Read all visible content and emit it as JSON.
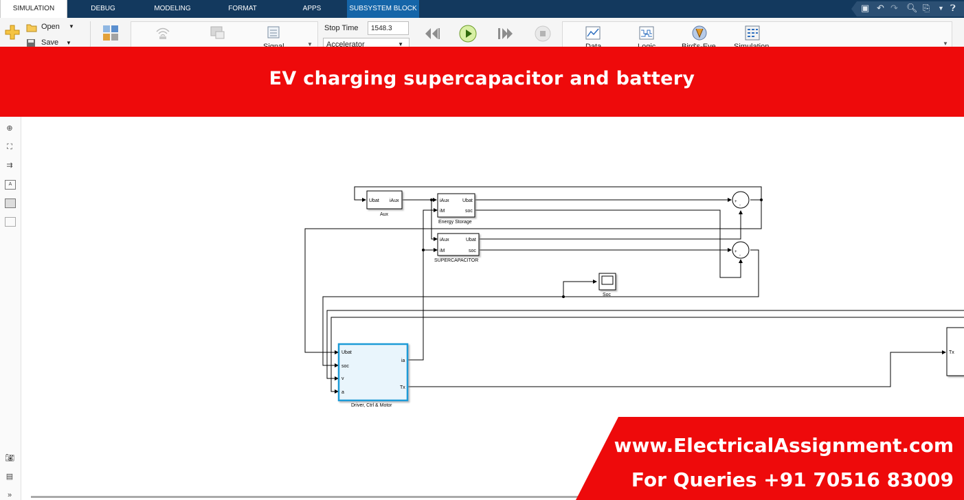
{
  "tabs": [
    "SIMULATION",
    "DEBUG",
    "MODELING",
    "FORMAT",
    "APPS",
    "SUBSYSTEM BLOCK"
  ],
  "ribbon": {
    "open_label": "Open",
    "save_label": "Save",
    "signal_label": "Signal",
    "stop_time_label": "Stop Time",
    "stop_time_value": "1548.3",
    "solver_mode": "Accelerator",
    "data_label": "Data",
    "logic_label": "Logic",
    "birds_eye_label": "Bird's-Eye",
    "simulation_label": "Simulation"
  },
  "banner": {
    "title": "EV charging supercapacitor and battery"
  },
  "blocks": {
    "aux": {
      "name": "Aux",
      "in": "Ubat",
      "out": "iAux"
    },
    "energy_storage": {
      "name": "Energy Storage",
      "in1": "iAux",
      "in2": "iM",
      "out1": "Ubat",
      "out2": "soc"
    },
    "supercap": {
      "name": "SUPERCAPACITOR",
      "in1": "iAux",
      "in2": "iM",
      "out1": "Ubat",
      "out2": "soc"
    },
    "scope": {
      "name": "Soc"
    },
    "driver": {
      "name": "Driver, Ctrl & Motor",
      "in1": "Ubat",
      "in2": "soc",
      "in3": "v",
      "in4": "a",
      "out1": "iа",
      "out2": "Tx"
    },
    "right_block": {
      "in": "Tx"
    },
    "sum_plus": "+",
    "sum_minus": "-"
  },
  "footer": {
    "website": "www.ElectricalAssignment.com",
    "queries": "For Queries +91 70516 83009"
  },
  "colors": {
    "banner_red": "#ee0a0b",
    "tabbar_blue": "#13395e",
    "subsystem_tab": "#1565a8",
    "selected_block": "#1a9bd7"
  }
}
